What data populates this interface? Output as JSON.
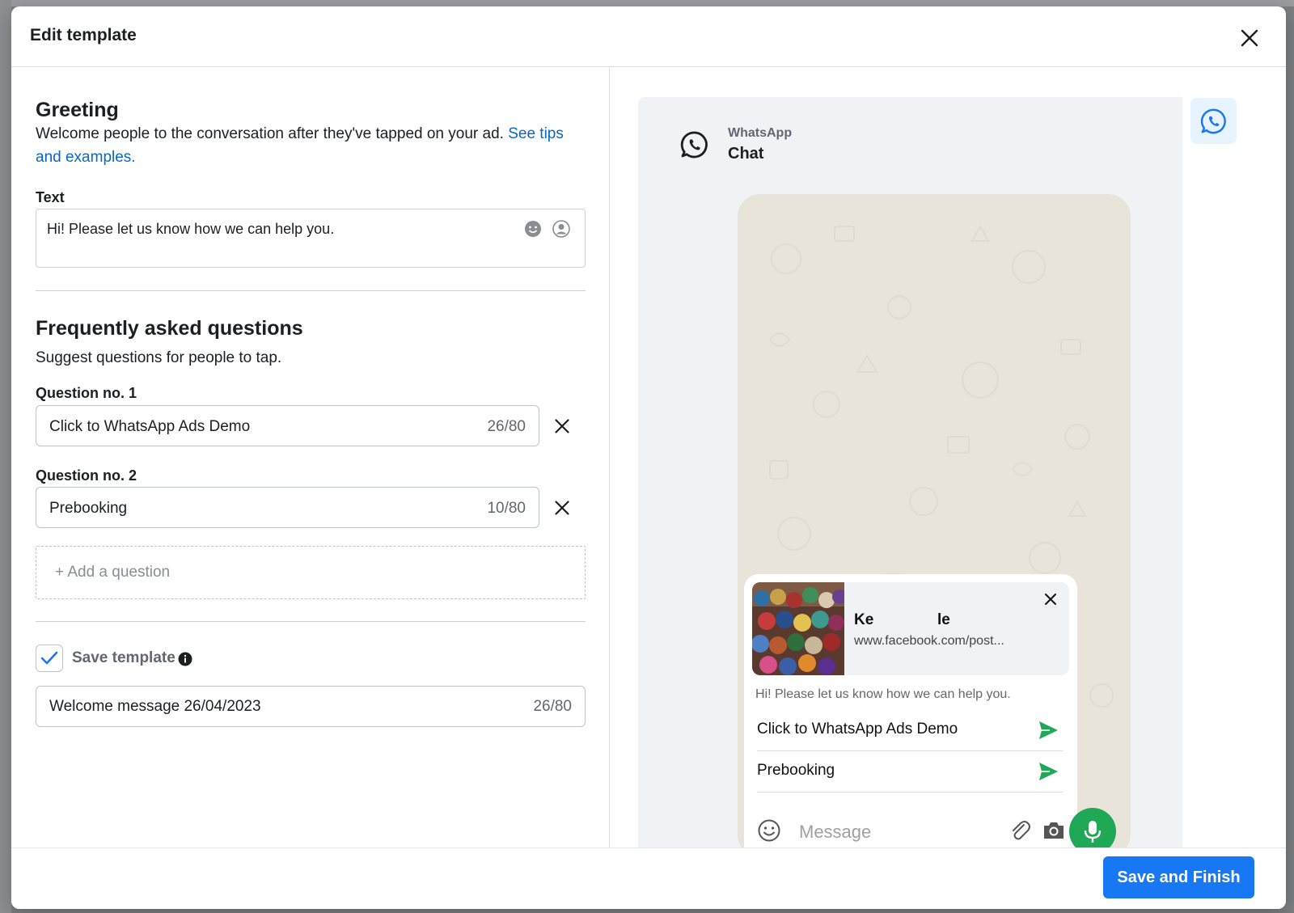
{
  "modal": {
    "title": "Edit template"
  },
  "greeting": {
    "title": "Greeting",
    "description": "Welcome people to the conversation after they've tapped on your ad.",
    "link_text": "See tips and examples.",
    "text_label": "Text",
    "text_value": "Hi! Please let us know how we can help you."
  },
  "faq": {
    "title": "Frequently asked questions",
    "description": "Suggest questions for people to tap.",
    "questions": [
      {
        "label": "Question no. 1",
        "value": "Click to WhatsApp Ads Demo",
        "count": "26/80"
      },
      {
        "label": "Question no. 2",
        "value": "Prebooking",
        "count": "10/80"
      }
    ],
    "add_question": "+ Add a question"
  },
  "save_template": {
    "label": "Save template",
    "checked": true,
    "name_value": "Welcome message 26/04/2023",
    "count": "26/80"
  },
  "preview": {
    "app_name": "WhatsApp",
    "chat_label": "Chat",
    "ad_title_start": "Ke",
    "ad_title_end": "le",
    "ad_url": "www.facebook.com/post...",
    "greeting": "Hi! Please let us know how we can help you.",
    "faq_items": [
      "Click to WhatsApp Ads Demo",
      "Prebooking"
    ],
    "message_placeholder": "Message",
    "accent_green": "#1fa855"
  },
  "footer": {
    "primary_label": "Save and Finish"
  },
  "colors": {
    "brand_blue": "#1877f2",
    "link_blue": "#0a66c2"
  }
}
